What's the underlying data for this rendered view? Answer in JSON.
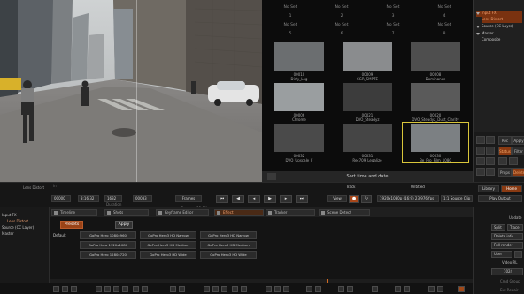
{
  "gallery": {
    "slots_top": [
      "No Set",
      "No Set",
      "No Set",
      "No Set"
    ],
    "slots_nums_1": [
      "1",
      "2",
      "3",
      "4"
    ],
    "slots_mid": [
      "No Set",
      "No Set",
      "No Set",
      "No Set"
    ],
    "slots_nums_2": [
      "5",
      "6",
      "7",
      "8"
    ],
    "thumbs": [
      {
        "num": "00010",
        "name": "Dirty_Log"
      },
      {
        "num": "00009",
        "name": "CGR_SMPTE"
      },
      {
        "num": "00008",
        "name": "Dominance"
      },
      {
        "num": "00006",
        "name": "Chrome"
      },
      {
        "num": "00021",
        "name": "DVO_Steadyz"
      },
      {
        "num": "00020",
        "name": "DVO_Steadyz_Dust_Clarity"
      },
      {
        "num": "00032",
        "name": "DVO_Upscale_F"
      },
      {
        "num": "00031",
        "name": "Rec709_Legalize"
      },
      {
        "num": "00030",
        "name": "Be_Pro_Film_1080"
      }
    ],
    "footer_label": "Sort time and date"
  },
  "tree": {
    "items": [
      {
        "label": "Input FX",
        "highlight": true
      },
      {
        "label": "Lens Distort",
        "highlight": true
      },
      {
        "label": "Source (CC Layer)",
        "highlight": false
      },
      {
        "label": "Master",
        "highlight": false
      },
      {
        "label": "Composite",
        "highlight": false
      }
    ]
  },
  "right_controls": {
    "row1": [
      "Rec",
      "Apply"
    ],
    "row2": [
      "Status",
      "Filter"
    ],
    "row3": [
      "Props",
      "Delete"
    ]
  },
  "transport": {
    "current_tool": "Lens Distort",
    "fields": [
      "00000",
      "3:16:32",
      "1632",
      "00033"
    ],
    "field_labels": [
      "In",
      "Out",
      "Duration",
      "Frame"
    ],
    "frames_label": "Frames",
    "zoom_label": "Zoom",
    "zoom_value": "98.6%",
    "source_title": "Untitled",
    "track_label": "Track",
    "resolution": "1920x1080p (16:9) 23.976 fps",
    "source_btn": "1:1 Source Clip",
    "play_output": "Play Output",
    "library": "Library",
    "home": "Home",
    "view_label": "View"
  },
  "tabs": [
    {
      "label": "Timeline",
      "active": false
    },
    {
      "label": "Shots",
      "active": false
    },
    {
      "label": "Keyframe Editor",
      "active": false
    },
    {
      "label": "Effect",
      "active": true
    },
    {
      "label": "Tracker",
      "active": false
    },
    {
      "label": "Scene Detect",
      "active": false
    }
  ],
  "layers": [
    {
      "label": "Input FX",
      "highlight": false
    },
    {
      "label": "Lens Distort",
      "highlight": true
    },
    {
      "label": "Source (CC Layer)",
      "highlight": false
    },
    {
      "label": "Master",
      "highlight": false
    }
  ],
  "presets": {
    "header": "Presets",
    "apply": "Apply",
    "category": "Default",
    "buttons": [
      [
        "GoPro Hero 1080x960",
        "GoPro Hero3 HD Narrow",
        "GoPro Hero3 HD Narrow"
      ],
      [
        "GoPro Hero 1920x1080",
        "GoPro Hero3 HD Medium",
        "GoPro Hero3 HD Medium"
      ],
      [
        "GoPro Hero 1280x720",
        "GoPro Hero3 HD Wide",
        "GoPro Hero3 HD Wide"
      ]
    ]
  },
  "right_lower": {
    "update": "Update",
    "split": "Split",
    "trace": "Trace",
    "delete_info": "Delete info",
    "full_render": "Full render",
    "user": "User",
    "video_label": "Video RL",
    "value": "1024",
    "cmd": "Cmd Group",
    "ext": "Ext Repair"
  },
  "colors": {
    "accent": "#d06a22",
    "selection": "#d9c63a",
    "active_bg": "#8a3a12"
  }
}
